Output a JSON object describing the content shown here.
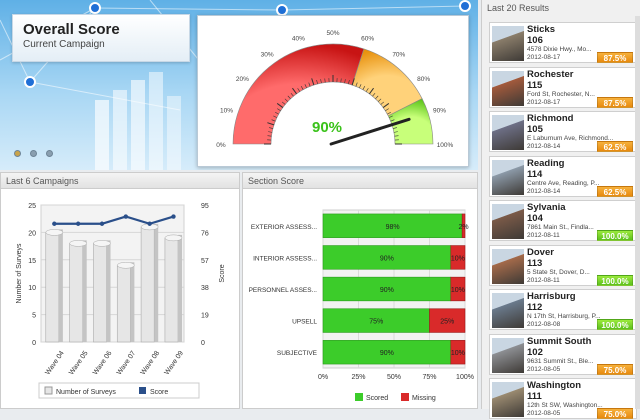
{
  "hero": {
    "title": "Overall Score",
    "subtitle": "Current Campaign",
    "gauge": {
      "value_label": "90%",
      "value": 90,
      "ticks": [
        "0%",
        "10%",
        "20%",
        "30%",
        "40%",
        "50%",
        "60%",
        "70%",
        "80%",
        "90%",
        "100%"
      ]
    },
    "slide_count": 3
  },
  "campaigns": {
    "title": "Last 6 Campaigns",
    "legend_surveys": "Number of Surveys",
    "legend_score": "Score",
    "chart_data": {
      "type": "bar",
      "categories": [
        "Wave 04",
        "Wave 05",
        "Wave 06",
        "Wave 07",
        "Wave 08",
        "Wave 09"
      ],
      "series": [
        {
          "name": "Number of Surveys",
          "values": [
            20,
            18,
            18,
            14,
            21,
            19
          ]
        },
        {
          "name": "Score",
          "values": [
            82,
            82,
            82,
            87,
            82,
            87
          ]
        }
      ],
      "ylabel": "Number of Surveys",
      "y2label": "Score",
      "ylim": [
        0,
        25
      ],
      "y2lim": [
        0,
        95
      ],
      "yticks": [
        "25",
        "20",
        "15",
        "10",
        "5",
        "0"
      ],
      "y2ticks": [
        "95",
        "76",
        "57",
        "38",
        "19",
        "0"
      ]
    }
  },
  "section": {
    "title": "Section Score",
    "legend_scored": "Scored",
    "legend_missing": "Missing",
    "chart_data": {
      "type": "bar",
      "categories": [
        "EXTERIOR ASSESS...",
        "INTERIOR ASSESS...",
        "PERSONNEL ASSES...",
        "UPSELL",
        "SUBJECTIVE"
      ],
      "series": [
        {
          "name": "Scored",
          "values": [
            98,
            90,
            90,
            75,
            90
          ]
        },
        {
          "name": "Missing",
          "values": [
            2,
            10,
            10,
            25,
            10
          ]
        }
      ],
      "value_labels": [
        "98%",
        "90%",
        "90%",
        "75%",
        "90%"
      ],
      "missing_labels": [
        "2%",
        "10%",
        "10%",
        "25%",
        "10%"
      ],
      "xticks": [
        "0%",
        "25%",
        "50%",
        "75%",
        "100%"
      ],
      "xlim": [
        0,
        100
      ]
    }
  },
  "results": {
    "title": "Last 20 Results",
    "items": [
      {
        "name": "Sticks",
        "score": "106",
        "address": "4578 Dixie Hwy., Mo...",
        "date": "2012-08-17",
        "badge": "87.5%",
        "badge_color": "orange"
      },
      {
        "name": "Rochester",
        "score": "115",
        "address": "Ford St, Rochester, N...",
        "date": "2012-08-17",
        "badge": "87.5%",
        "badge_color": "orange"
      },
      {
        "name": "Richmond",
        "score": "105",
        "address": "E Laburnum Ave, Richmond...",
        "date": "2012-08-14",
        "badge": "62.5%",
        "badge_color": "orange"
      },
      {
        "name": "Reading",
        "score": "114",
        "address": "Centre Ave, Reading, P...",
        "date": "2012-08-14",
        "badge": "62.5%",
        "badge_color": "orange"
      },
      {
        "name": "Sylvania",
        "score": "104",
        "address": "7861 Main St., Findla...",
        "date": "2012-08-11",
        "badge": "100.0%",
        "badge_color": "green"
      },
      {
        "name": "Dover",
        "score": "113",
        "address": "5 State St, Dover, D...",
        "date": "2012-08-11",
        "badge": "100.0%",
        "badge_color": "green"
      },
      {
        "name": "Harrisburg",
        "score": "112",
        "address": "N 17th St, Harrisburg, P...",
        "date": "2012-08-08",
        "badge": "100.0%",
        "badge_color": "green"
      },
      {
        "name": "Summit South",
        "score": "102",
        "address": "9631 Summit St., Ble...",
        "date": "2012-08-05",
        "badge": "75.0%",
        "badge_color": "orange"
      },
      {
        "name": "Washington",
        "score": "111",
        "address": "12th St SW, Washington...",
        "date": "2012-08-05",
        "badge": "75.0%",
        "badge_color": "orange"
      }
    ]
  }
}
